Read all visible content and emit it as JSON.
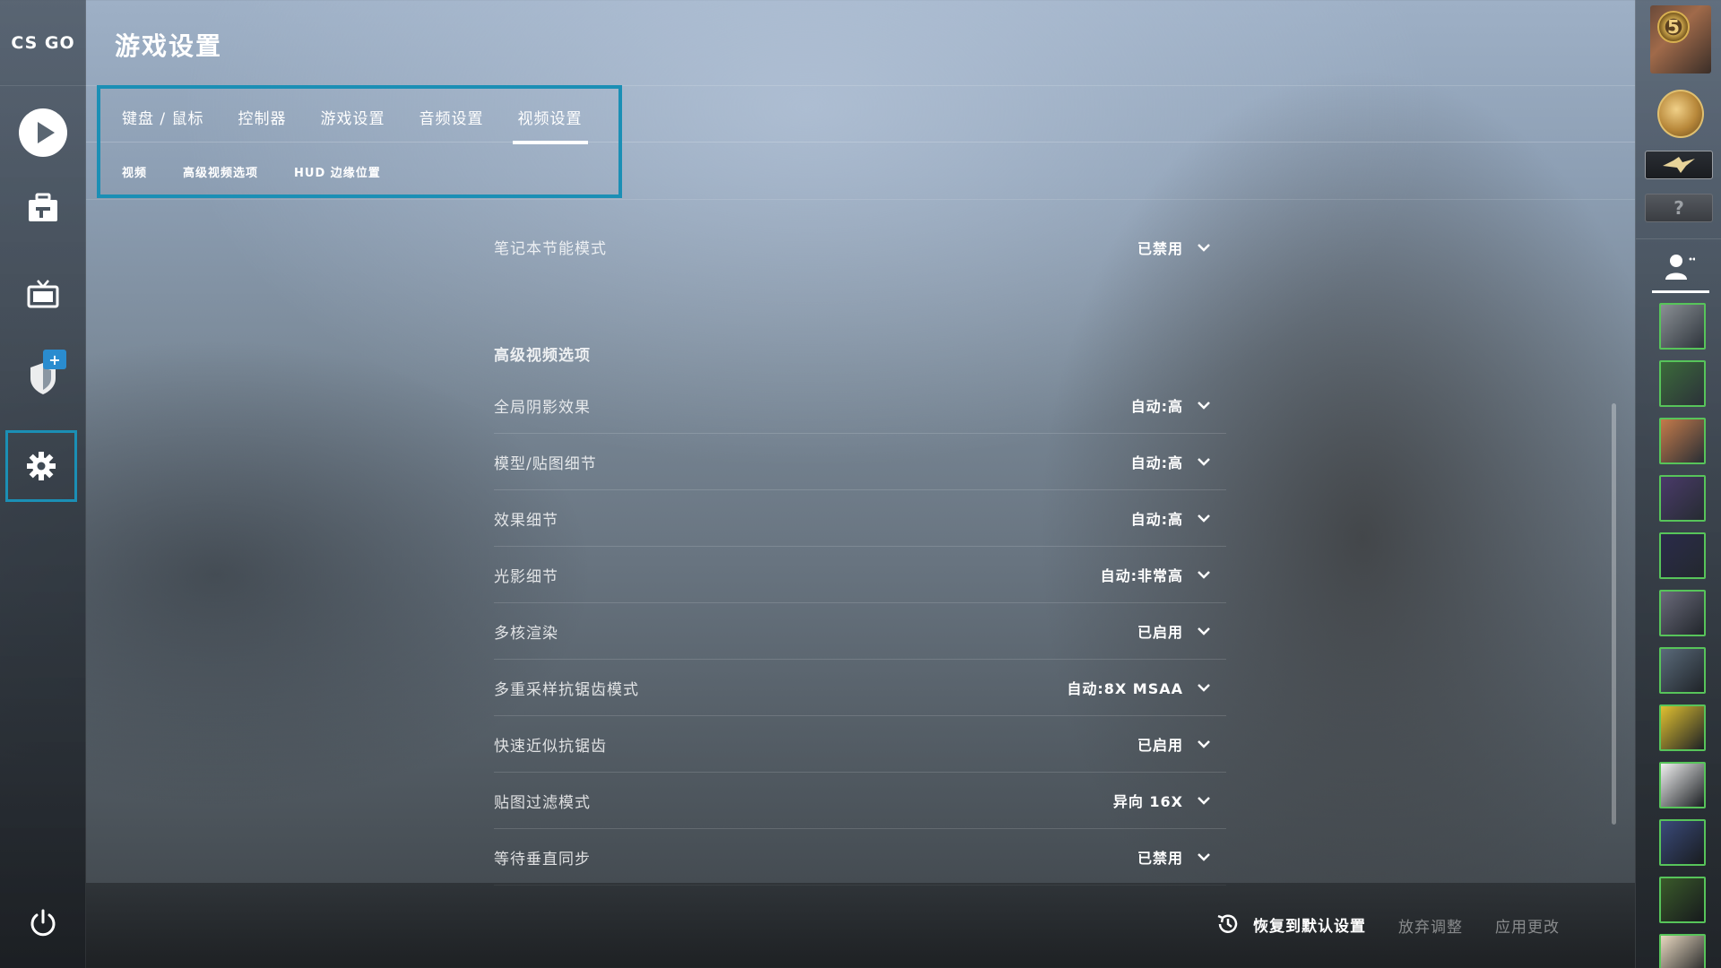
{
  "app": {
    "logo_text": "CS GO"
  },
  "header": {
    "title": "游戏设置"
  },
  "left_nav": [
    {
      "name": "play",
      "icon": "play-icon"
    },
    {
      "name": "inventory",
      "icon": "briefcase-icon"
    },
    {
      "name": "watch",
      "icon": "tv-icon"
    },
    {
      "name": "operation",
      "icon": "shield-icon",
      "badge": "+"
    },
    {
      "name": "settings",
      "icon": "gear-icon",
      "active": true
    },
    {
      "name": "power",
      "icon": "power-icon"
    }
  ],
  "tabs": [
    {
      "label": "键盘 / 鼠标"
    },
    {
      "label": "控制器"
    },
    {
      "label": "游戏设置"
    },
    {
      "label": "音频设置"
    },
    {
      "label": "视频设置",
      "active": true
    }
  ],
  "subtabs": [
    {
      "label": "视频"
    },
    {
      "label": "高级视频选项"
    },
    {
      "label": "HUD 边缘位置"
    }
  ],
  "settings": {
    "laptop_power": {
      "label": "笔记本节能模式",
      "value": "已禁用"
    },
    "advanced_section_title": "高级视频选项",
    "rows": [
      {
        "label": "全局阴影效果",
        "value": "自动:高"
      },
      {
        "label": "模型/贴图细节",
        "value": "自动:高"
      },
      {
        "label": "效果细节",
        "value": "自动:高"
      },
      {
        "label": "光影细节",
        "value": "自动:非常高"
      },
      {
        "label": "多核渲染",
        "value": "已启用"
      },
      {
        "label": "多重采样抗锯齿模式",
        "value": "自动:8X MSAA"
      },
      {
        "label": "快速近似抗锯齿",
        "value": "已启用"
      },
      {
        "label": "贴图过滤模式",
        "value": "异向 16X"
      },
      {
        "label": "等待垂直同步",
        "value": "已禁用"
      }
    ]
  },
  "bottom_bar": {
    "restore_label": "恢复到默认设置",
    "discard_label": "放弃调整",
    "apply_label": "应用更改"
  },
  "right_bar": {
    "rank_number": "5",
    "unknown_rank": "?",
    "friend_avatar_colors": [
      "#8a8f94",
      "#3b6a3a",
      "#c47a4a",
      "#4a3a6a",
      "#2a2a4a",
      "#6a6a7a",
      "#5a6a7a",
      "#e0c030",
      "#f0f0f0",
      "#3a4a7a",
      "#3a5a2a",
      "#e8d8c0"
    ]
  },
  "colors": {
    "accent": "#1b8fb5",
    "online": "#57c45a"
  }
}
